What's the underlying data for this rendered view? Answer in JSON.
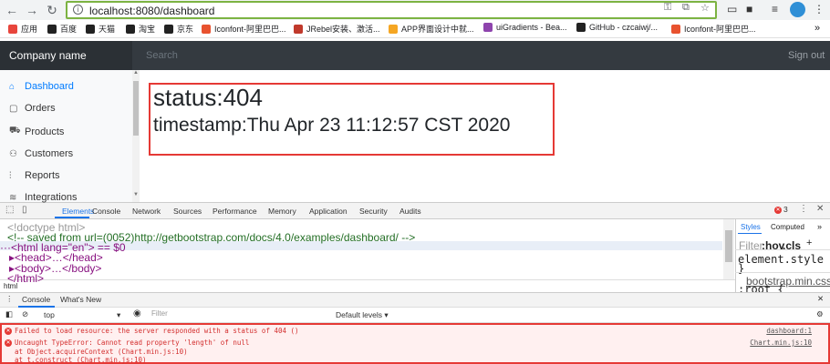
{
  "browser": {
    "url": "localhost:8080/dashboard",
    "bookmarks": [
      {
        "label": "应用",
        "color": "#e8453c"
      },
      {
        "label": "百度",
        "color": "#222"
      },
      {
        "label": "天猫",
        "color": "#222"
      },
      {
        "label": "淘宝",
        "color": "#222"
      },
      {
        "label": "京东",
        "color": "#222"
      },
      {
        "label": "Iconfont-阿里巴巴...",
        "color": "#e8522f"
      },
      {
        "label": "JRebel安装、激活...",
        "color": "#c0392b"
      },
      {
        "label": "APP界面设计中就...",
        "color": "#f5a623"
      },
      {
        "label": "uiGradients - Bea...",
        "color": "#8e44ad"
      },
      {
        "label": "GitHub - czcaiwj/...",
        "color": "#222"
      },
      {
        "label": "Iconfont-阿里巴巴...",
        "color": "#e8522f"
      }
    ],
    "more_bookmarks": "»"
  },
  "app": {
    "brand": "Company name",
    "search_placeholder": "Search",
    "signout": "Sign out",
    "sidebar": [
      {
        "label": "Dashboard",
        "icon": "home-icon",
        "glyph": "⌂",
        "active": true
      },
      {
        "label": "Orders",
        "icon": "file-icon",
        "glyph": "▢"
      },
      {
        "label": "Products",
        "icon": "cart-icon",
        "glyph": "⛟"
      },
      {
        "label": "Customers",
        "icon": "users-icon",
        "glyph": "⚇"
      },
      {
        "label": "Reports",
        "icon": "bar-chart-icon",
        "glyph": "⫶"
      },
      {
        "label": "Integrations",
        "icon": "layers-icon",
        "glyph": "≋"
      }
    ],
    "status_text": "status:404",
    "timestamp_text": "timestamp:Thu Apr 23 11:12:57 CST 2020"
  },
  "devtools": {
    "tabs": [
      "Elements",
      "Console",
      "Network",
      "Sources",
      "Performance",
      "Memory",
      "Application",
      "Security",
      "Audits"
    ],
    "error_count": "3",
    "elements": [
      "<!doctype html>",
      "<!-- saved from url=(0052)http://getbootstrap.com/docs/4.0/examples/dashboard/ -->",
      "···<html lang=\"en\"> == $0",
      "▸<head>…</head>",
      "▸<body>…</body>",
      "</html>"
    ],
    "breadcrumb": "html",
    "styles_tabs": [
      "Styles",
      "Computed",
      "»"
    ],
    "styles_filter": "Filter",
    "styles_hov": ":hov",
    "styles_cls": ".cls",
    "styles_plus": "+",
    "styles_lines": [
      "element.style {",
      "}",
      "bootstrap.min.css…",
      ":root {"
    ],
    "drawer_tabs": [
      "Console",
      "What's New"
    ],
    "context": "top",
    "filter_placeholder": "Filter",
    "levels": "Default levels ▾",
    "errors": [
      {
        "text": "Failed to load resource: the server responded with a status of 404 ()",
        "source": "dashboard:1"
      },
      {
        "text": "Uncaught TypeError: Cannot read property 'length' of null",
        "source": "Chart.min.js:10"
      },
      {
        "text": "    at Object.acquireContext (Chart.min.js:10)",
        "source": ""
      },
      {
        "text": "    at t.construct (Chart.min.js:10)",
        "source": ""
      }
    ]
  }
}
